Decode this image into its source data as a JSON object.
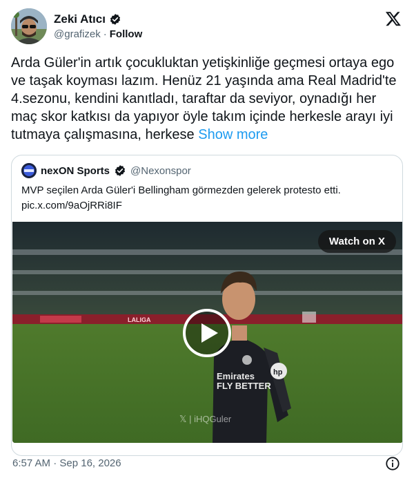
{
  "author": {
    "name": "Zeki Atıcı",
    "handle": "@grafizek",
    "separator": "·",
    "follow_label": "Follow",
    "verified": true
  },
  "tweet": {
    "text": "Arda Güler'in artık çocukluktan yetişkinliğe geçmesi ortaya ego ve taşak koyması lazım. Henüz 21 yaşında ama Real Madrid'te 4.sezonu, kendini kanıtladı, taraftar da seviyor, oynadığı her maç skor katkısı da yapıyor öyle takım içinde herkesle arayı iyi tutmaya çalışmasına, herkese",
    "show_more_label": "Show more"
  },
  "quoted": {
    "name": "nexON Sports",
    "handle": "@Nexonspor",
    "verified": true,
    "text": "MVP seçilen Arda Güler'i Bellingham görmezden gelerek protesto etti.",
    "link": "pic.x.com/9aOjRRi8IF",
    "video": {
      "watch_label": "Watch on X",
      "watermark": "𝕏 | iHQGuler",
      "sponsor_labels": [
        "LALIGA"
      ],
      "shirt_sponsor": "Emirates\nFLY BETTER",
      "shirt_logo": "hp"
    }
  },
  "footer": {
    "timestamp": "6:57 AM · Sep 16, 2026"
  },
  "icons": {
    "brand": "x-logo-icon",
    "verified": "verified-badge-icon",
    "play": "play-icon",
    "info": "info-icon"
  },
  "colors": {
    "link": "#1d9bf0",
    "secondary_text": "#536471",
    "border": "#cfd9de",
    "verified": "#0f1419"
  }
}
